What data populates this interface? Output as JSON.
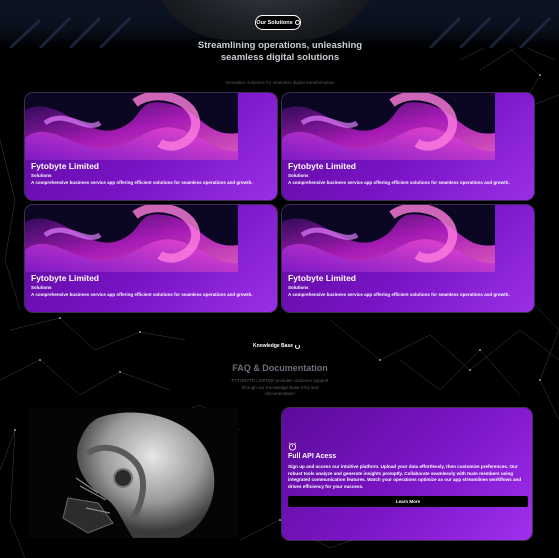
{
  "hero": {
    "badge_label": "Our Solutions",
    "title": "Streamlining operations, unleashing seamless digital solutions",
    "subtitle": "Innovative solutions for seamless digital transformation"
  },
  "cards": [
    {
      "name": "Fytobyte Limited",
      "tag": "Solutions",
      "description": "A comprehensive business service app offering efficient solutions for seamless operations and growth."
    },
    {
      "name": "Fytobyte Limited",
      "tag": "Solutions",
      "description": "A comprehensive business service app offering efficient solutions for seamless operations and growth."
    },
    {
      "name": "Fytobyte Limited",
      "tag": "Solutions",
      "description": "A comprehensive business service app offering efficient solutions for seamless operations and growth."
    },
    {
      "name": "Fytobyte Limited",
      "tag": "Solutions",
      "description": "A comprehensive business service app offering efficient solutions for seamless operations and growth."
    }
  ],
  "knowledge": {
    "label": "Knowledge Base"
  },
  "faq": {
    "title": "FAQ & Documentation",
    "body": "FYTOBYTE LIMITED provides customer support through our Knowledge Base FAQ and documentation"
  },
  "api_card": {
    "title": "Full API Acess",
    "text": "Sign up and access our intuitive platform. Upload your data effortlessly, then customize preferences. Our robust tools analyze and generate insights promptly. Collaborate seamlessly with team members using integrated communication features. Watch your operations optimize as our app streamlines workflows and drives efficiency for your success.",
    "button_label": "Learn More"
  },
  "colors": {
    "accent": "#7a14c6",
    "background": "#000000"
  }
}
